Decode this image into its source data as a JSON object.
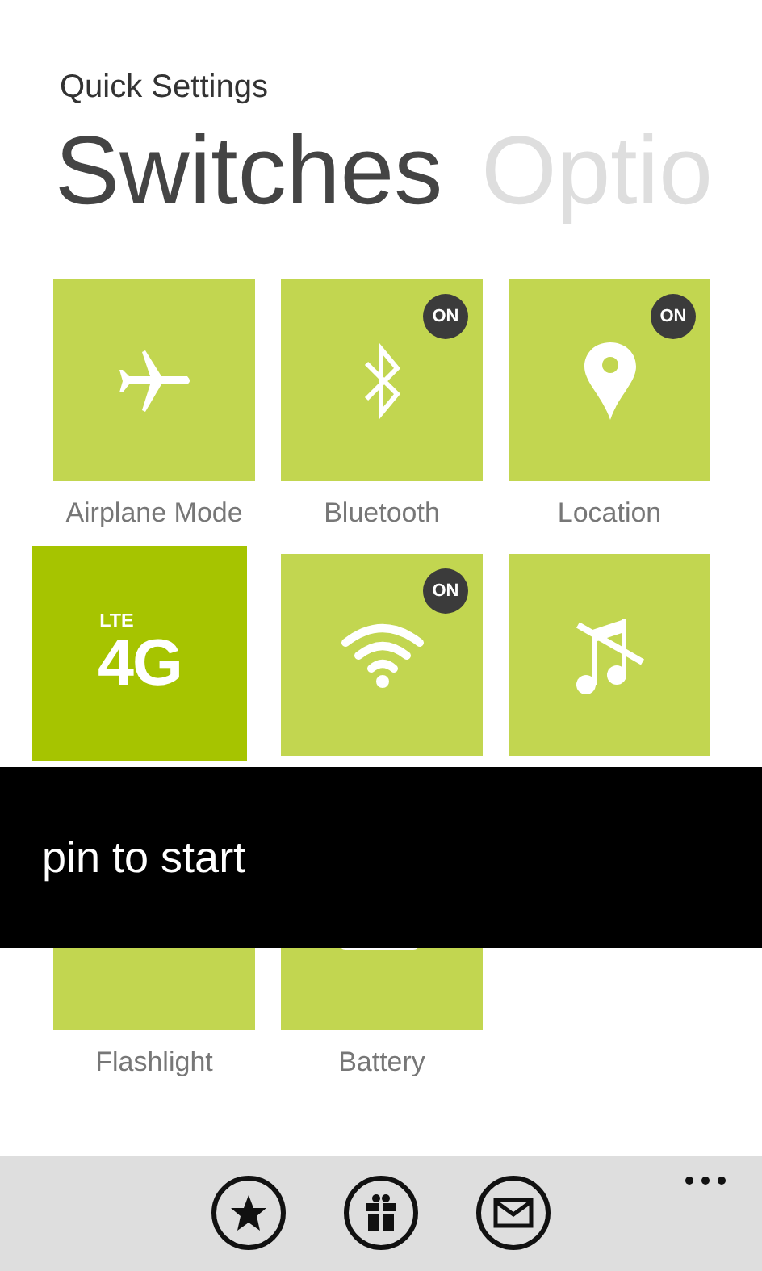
{
  "app_title": "Quick Settings",
  "pivot": [
    {
      "label": "Switches",
      "selected": true
    },
    {
      "label": "Optio",
      "selected": false
    }
  ],
  "tiles": [
    {
      "kind": "airplane",
      "label": "Airplane Mode",
      "pressed": false
    },
    {
      "kind": "bluetooth",
      "label": "Bluetooth",
      "badge": "ON",
      "pressed": false
    },
    {
      "kind": "location",
      "label": "Location",
      "badge": "ON",
      "pressed": false
    },
    {
      "kind": "cellular",
      "small_text": "LTE",
      "big_text": "4G",
      "pressed": true
    },
    {
      "kind": "wifi",
      "badge": "ON",
      "pressed": false
    },
    {
      "kind": "mute",
      "pressed": false
    },
    {
      "kind": "flashlight",
      "label": "Flashlight",
      "pressed": false
    },
    {
      "kind": "battery",
      "label": "Battery",
      "pressed": false
    }
  ],
  "context_menu": {
    "items": [
      "pin to start"
    ]
  },
  "app_bar": {
    "buttons": [
      {
        "kind": "star"
      },
      {
        "kind": "gift"
      },
      {
        "kind": "mail"
      }
    ]
  }
}
